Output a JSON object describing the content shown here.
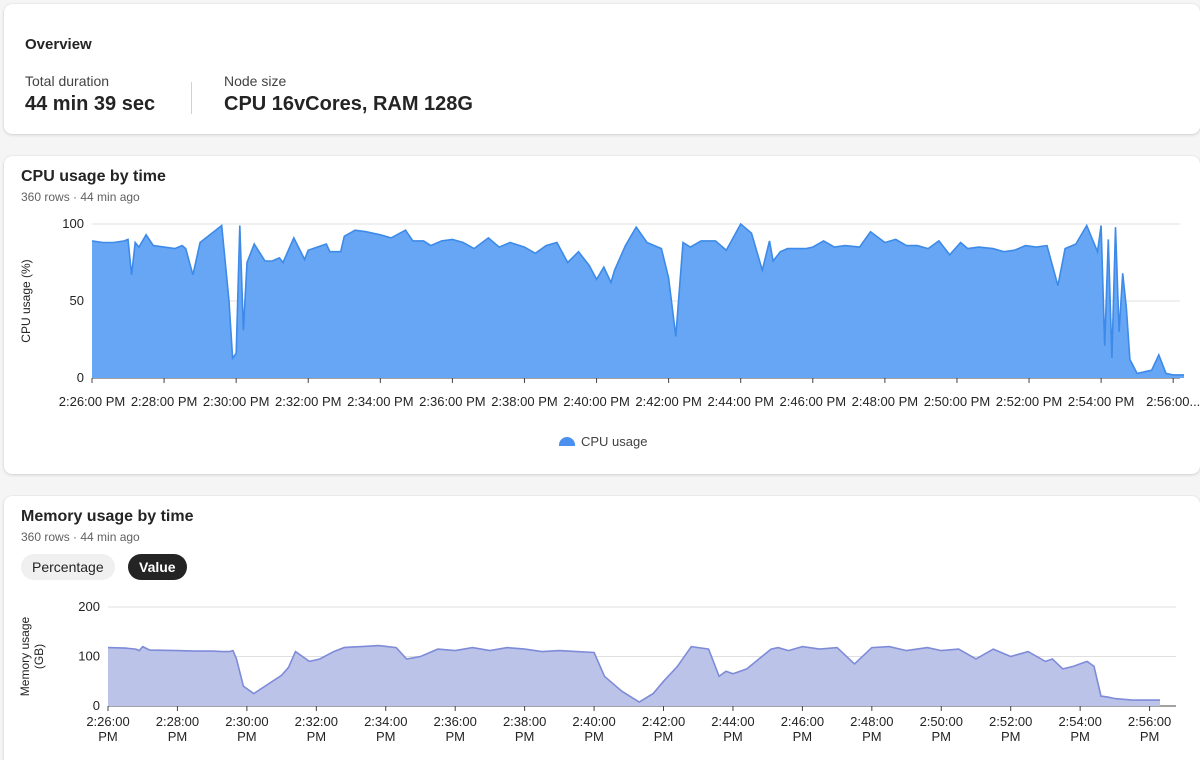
{
  "overview": {
    "title": "Overview",
    "total_duration_label": "Total duration",
    "total_duration_value": "44 min 39 sec",
    "node_size_label": "Node size",
    "node_size_value": "CPU 16vCores, RAM 128G"
  },
  "cpu_card": {
    "title": "CPU usage by time",
    "subtitle": "360 rows · 44 min ago",
    "legend": "CPU usage"
  },
  "memory_card": {
    "title": "Memory usage by time",
    "subtitle": "360 rows · 44 min ago",
    "toggle_percentage": "Percentage",
    "toggle_value": "Value"
  },
  "colors": {
    "cpu_fill": "#66a6f5",
    "cpu_line": "#3d8ae8",
    "mem_fill": "#bcc3e8",
    "mem_line": "#7e8bd9"
  },
  "chart_data": [
    {
      "type": "area",
      "title": "CPU usage by time",
      "ylabel": "CPU usage (%)",
      "xlabel": "",
      "ylim": [
        0,
        100
      ],
      "yticks": [
        0,
        50,
        100
      ],
      "x_range_minutes": [
        0,
        30.3
      ],
      "x_start_label": "2:26:00 PM",
      "x_tick_labels": [
        "2:26:00 PM",
        "2:28:00 PM",
        "2:30:00 PM",
        "2:32:00 PM",
        "2:34:00 PM",
        "2:36:00 PM",
        "2:38:00 PM",
        "2:40:00 PM",
        "2:42:00 PM",
        "2:44:00 PM",
        "2:46:00 PM",
        "2:48:00 PM",
        "2:50:00 PM",
        "2:52:00 PM",
        "2:54:00 PM",
        "2:56:00..."
      ],
      "legend": "bottom-center",
      "grid": true,
      "series": [
        {
          "name": "CPU usage",
          "x": [
            0,
            0.3,
            0.6,
            0.9,
            1.0,
            1.1,
            1.2,
            1.3,
            1.5,
            1.7,
            2.0,
            2.3,
            2.5,
            2.6,
            2.8,
            3.0,
            3.6,
            3.8,
            3.9,
            4.0,
            4.1,
            4.2,
            4.3,
            4.5,
            4.8,
            5.0,
            5.2,
            5.3,
            5.6,
            5.9,
            6.0,
            6.5,
            6.6,
            6.9,
            7.0,
            7.3,
            7.6,
            8.0,
            8.3,
            8.7,
            8.9,
            9.2,
            9.4,
            9.7,
            10.0,
            10.3,
            10.6,
            11.0,
            11.3,
            11.6,
            12.0,
            12.3,
            12.6,
            12.9,
            13.2,
            13.5,
            13.8,
            14.0,
            14.2,
            14.4,
            14.5,
            14.8,
            15.1,
            15.4,
            15.8,
            16.0,
            16.2,
            16.4,
            16.6,
            16.9,
            17.3,
            17.6,
            18.0,
            18.3,
            18.6,
            18.8,
            18.9,
            19.1,
            19.3,
            19.6,
            19.8,
            20.0,
            20.3,
            20.6,
            20.9,
            21.3,
            21.6,
            22.0,
            22.3,
            22.6,
            22.9,
            23.2,
            23.5,
            23.8,
            24.1,
            24.3,
            24.6,
            25.0,
            25.3,
            25.6,
            25.9,
            26.2,
            26.5,
            26.8,
            27.0,
            27.3,
            27.6,
            27.9,
            28.0,
            28.1,
            28.2,
            28.3,
            28.4,
            28.5,
            28.6,
            28.7,
            28.8,
            29.0,
            29.2,
            29.4,
            29.6,
            29.8,
            30.0,
            30.3
          ],
          "values": [
            89,
            88,
            88,
            89,
            90,
            67,
            88,
            85,
            93,
            86,
            85,
            84,
            86,
            84,
            67,
            88,
            99,
            50,
            13,
            16,
            99,
            31,
            75,
            87,
            76,
            76,
            78,
            75,
            91,
            77,
            83,
            87,
            82,
            82,
            92,
            96,
            95,
            93,
            91,
            96,
            89,
            89,
            86,
            89,
            90,
            88,
            84,
            91,
            85,
            88,
            85,
            81,
            86,
            88,
            75,
            82,
            73,
            64,
            72,
            62,
            70,
            86,
            98,
            88,
            84,
            65,
            27,
            88,
            85,
            89,
            89,
            83,
            100,
            94,
            70,
            89,
            76,
            82,
            84,
            84,
            84,
            85,
            89,
            85,
            86,
            85,
            95,
            88,
            90,
            86,
            86,
            84,
            89,
            80,
            88,
            84,
            85,
            84,
            82,
            83,
            86,
            85,
            86,
            60,
            84,
            87,
            99,
            82,
            99,
            21,
            90,
            13,
            98,
            30,
            68,
            46,
            12,
            3,
            4,
            5,
            15,
            3,
            2,
            2
          ]
        }
      ]
    },
    {
      "type": "area",
      "title": "Memory usage by time",
      "ylabel": "Memory usage (GB)",
      "xlabel": "",
      "ylim": [
        0,
        200
      ],
      "yticks": [
        0,
        100,
        200
      ],
      "x_range_minutes": [
        0,
        30.3
      ],
      "x_start_label": "2:26:00 PM",
      "x_tick_labels": [
        [
          "2:26:00",
          "PM"
        ],
        [
          "2:28:00",
          "PM"
        ],
        [
          "2:30:00",
          "PM"
        ],
        [
          "2:32:00",
          "PM"
        ],
        [
          "2:34:00",
          "PM"
        ],
        [
          "2:36:00",
          "PM"
        ],
        [
          "2:38:00",
          "PM"
        ],
        [
          "2:40:00",
          "PM"
        ],
        [
          "2:42:00",
          "PM"
        ],
        [
          "2:44:00",
          "PM"
        ],
        [
          "2:46:00",
          "PM"
        ],
        [
          "2:48:00",
          "PM"
        ],
        [
          "2:50:00",
          "PM"
        ],
        [
          "2:52:00",
          "PM"
        ],
        [
          "2:54:00",
          "PM"
        ],
        [
          "2:56:00",
          "PM"
        ]
      ],
      "legend": "none",
      "grid": true,
      "series": [
        {
          "name": "Memory usage",
          "x": [
            0,
            0.5,
            0.8,
            0.9,
            1.0,
            1.2,
            2.0,
            2.5,
            3.0,
            3.3,
            3.5,
            3.6,
            3.7,
            3.9,
            4.2,
            5.0,
            5.2,
            5.4,
            5.8,
            6.1,
            6.5,
            6.8,
            7.0,
            7.3,
            7.8,
            8.3,
            8.6,
            9.0,
            9.5,
            10.0,
            10.5,
            11.0,
            11.5,
            12.0,
            12.5,
            13.0,
            13.5,
            14.0,
            14.3,
            14.8,
            15.3,
            15.7,
            16.0,
            16.4,
            16.8,
            17.3,
            17.6,
            17.8,
            18.0,
            18.4,
            18.8,
            19.1,
            19.3,
            19.6,
            20.0,
            20.5,
            21.0,
            21.5,
            22.0,
            22.5,
            23.0,
            23.3,
            23.6,
            24.0,
            24.5,
            25.0,
            25.5,
            26.0,
            26.5,
            27.0,
            27.2,
            27.5,
            27.8,
            28.0,
            28.2,
            28.4,
            28.6,
            28.8,
            29.0,
            29.5,
            30.0,
            30.3
          ],
          "values": [
            118,
            117,
            115,
            112,
            120,
            113,
            112,
            111,
            111,
            110,
            110,
            112,
            95,
            40,
            25,
            62,
            78,
            110,
            90,
            95,
            110,
            118,
            119,
            120,
            122,
            118,
            95,
            100,
            115,
            112,
            118,
            112,
            118,
            115,
            110,
            112,
            110,
            108,
            60,
            30,
            8,
            25,
            50,
            80,
            120,
            115,
            60,
            70,
            65,
            75,
            98,
            115,
            118,
            112,
            120,
            115,
            118,
            85,
            118,
            120,
            112,
            115,
            118,
            112,
            115,
            95,
            115,
            100,
            110,
            90,
            95,
            75,
            80,
            85,
            90,
            80,
            20,
            18,
            15,
            12,
            12,
            12
          ]
        }
      ]
    }
  ]
}
